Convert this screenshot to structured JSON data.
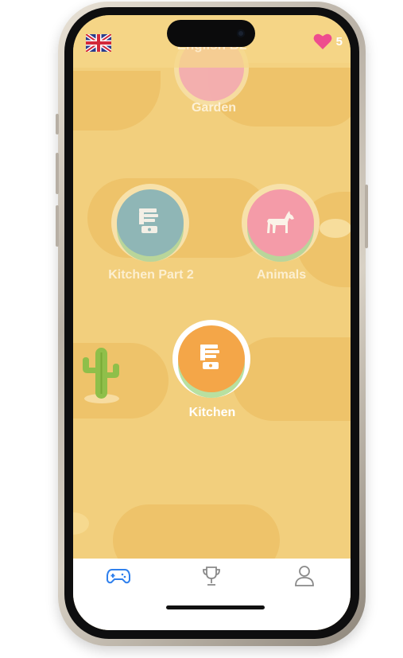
{
  "header": {
    "title": "English B2",
    "language_flag": "uk-flag-icon",
    "hearts_icon": "heart-icon",
    "hearts_count": "5"
  },
  "lessons": [
    {
      "label": "Garden",
      "icon": "flower-icon",
      "state": "locked",
      "color": "#f2a3b1"
    },
    {
      "label": "Kitchen Part 2",
      "icon": "blender-icon",
      "state": "locked",
      "color": "#8fb6b6"
    },
    {
      "label": "Animals",
      "icon": "horse-icon",
      "state": "locked",
      "color": "#f49ba8"
    },
    {
      "label": "Kitchen",
      "icon": "blender-icon",
      "state": "current",
      "color": "#f4a648"
    }
  ],
  "tabbar": {
    "tabs": [
      {
        "icon": "gamepad-icon",
        "active": true
      },
      {
        "icon": "trophy-icon",
        "active": false
      },
      {
        "icon": "profile-icon",
        "active": false
      }
    ],
    "active_color": "#2f80ed",
    "inactive_color": "#8a8a8a"
  },
  "theme": {
    "background": "#f2cf7d",
    "path": "#eec36a"
  }
}
